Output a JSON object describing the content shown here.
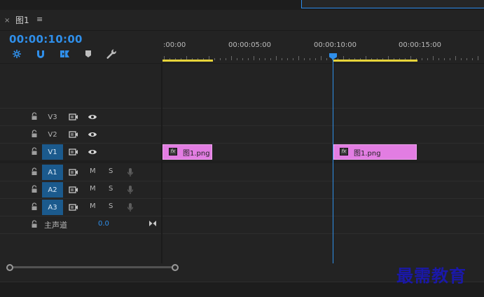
{
  "tab": {
    "close": "×",
    "title": "图1",
    "menu": "≡"
  },
  "header": {
    "timecode": "00:00:10:00"
  },
  "tools": [
    {
      "name": "nest-icon"
    },
    {
      "name": "snap-magnet-icon"
    },
    {
      "name": "linked-selection-icon"
    },
    {
      "name": "add-marker-icon"
    },
    {
      "name": "settings-wrench-icon"
    }
  ],
  "ruler": {
    "labels": [
      ":00:00",
      "00:00:05:00",
      "00:00:10:00",
      "00:00:15:00"
    ]
  },
  "tracks": {
    "video": [
      {
        "label": "V3",
        "active": false
      },
      {
        "label": "V2",
        "active": false
      },
      {
        "label": "V1",
        "active": true
      }
    ],
    "audio": [
      {
        "label": "A1",
        "mute": "M",
        "solo": "S"
      },
      {
        "label": "A2",
        "mute": "M",
        "solo": "S"
      },
      {
        "label": "A3",
        "mute": "M",
        "solo": "S"
      }
    ],
    "master": {
      "label": "主声道",
      "value": "0.0"
    }
  },
  "clips": [
    {
      "name": "图1.png",
      "fx": "fx"
    },
    {
      "name": "图1.png",
      "fx": "fx"
    }
  ],
  "watermark": "最需教育",
  "colors": {
    "accent": "#2f8fea",
    "clip": "#e27de2",
    "work_area": "#e6d33a",
    "active_track": "#1b5a8d"
  }
}
